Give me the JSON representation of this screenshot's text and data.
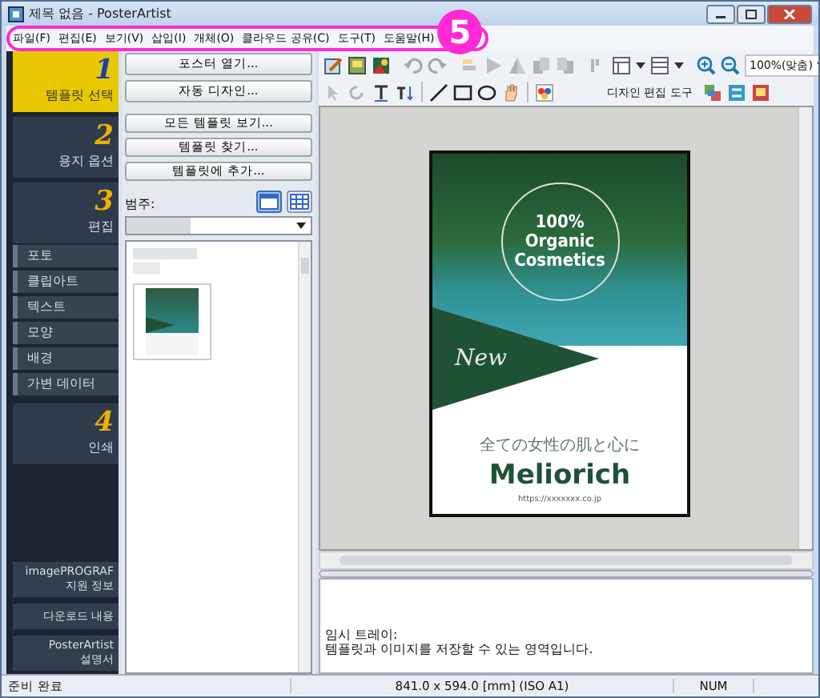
{
  "window": {
    "title": "제목 없음 - PosterArtist"
  },
  "menu": [
    "파일(F)",
    "편집(E)",
    "보기(V)",
    "삽입(I)",
    "개체(O)",
    "클라우드 공유(C)",
    "도구(T)",
    "도움말(H)"
  ],
  "callout": {
    "number": "5"
  },
  "steps": [
    {
      "number": "1",
      "label": "템플릿 선택",
      "selected": true
    },
    {
      "number": "2",
      "label": "용지 옵션",
      "selected": false
    },
    {
      "number": "3",
      "label": "편집",
      "selected": false,
      "children": [
        "포토",
        "클립아트",
        "텍스트",
        "모양",
        "배경",
        "가변 데이터"
      ]
    },
    {
      "number": "4",
      "label": "인쇄",
      "selected": false
    }
  ],
  "nav_links": [
    "imagePROGRAF\n지원 정보",
    "다운로드 내용",
    "PosterArtist\n설명서"
  ],
  "actions": [
    "포스터 열기...",
    "자동 디자인...",
    "모든 템플릿 보기...",
    "템플릿 찾기...",
    "템플릿에 추가..."
  ],
  "category": {
    "label": "범주:"
  },
  "view_modes": [
    {
      "selected": true
    },
    {
      "selected": false
    }
  ],
  "toolbar": {
    "zoom": "100%(맞춤)",
    "design_tools": "디자인 편집 도구"
  },
  "poster": {
    "badge": "100%\nOrganic\nCosmetics",
    "tag": "New",
    "tagline": "全ての女性の肌と心に",
    "brand": "Meliorich",
    "url": "https://xxxxxxx.co.jp"
  },
  "tray": {
    "title": "임시 트레이:",
    "text": "템플릿과 이미지를 저장할 수 있는 영역입니다."
  },
  "status_bar": [
    "준비 완료",
    "841.0 x 594.0 [mm] (ISO A1)",
    "NUM"
  ]
}
